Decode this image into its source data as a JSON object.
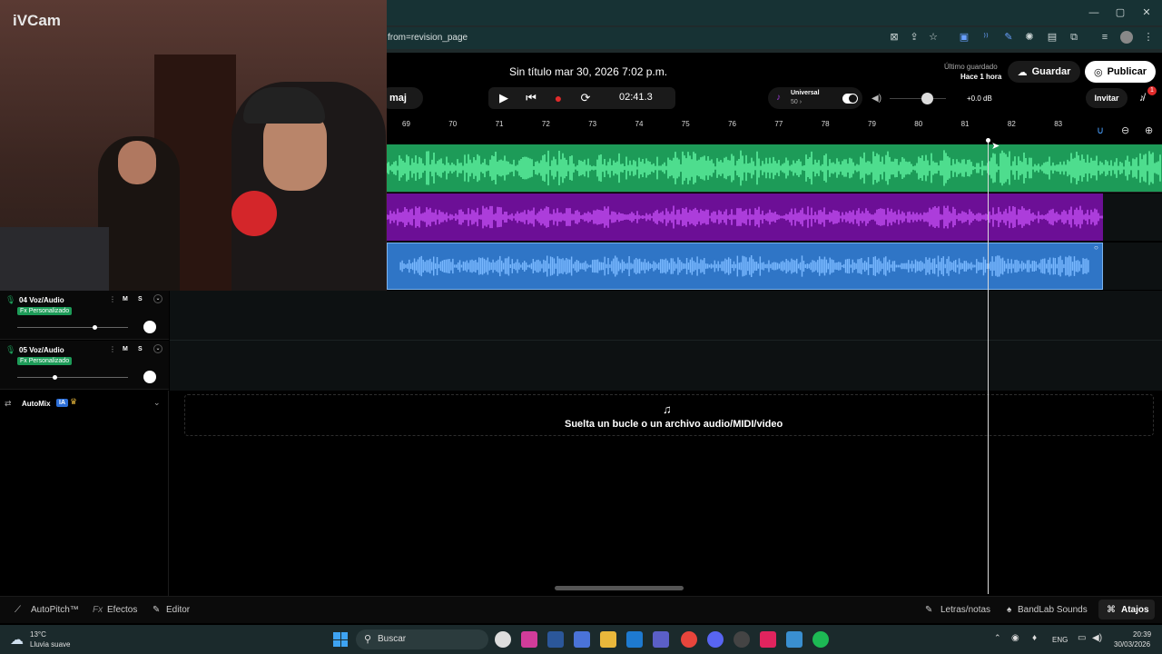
{
  "webcam": {
    "label": "iVCam"
  },
  "browser": {
    "url": "from=revision_page"
  },
  "header": {
    "title": "Sin título mar 30, 2026 7:02 p.m.",
    "saved_label": "Último guardado",
    "saved_time": "Hace 1 hora",
    "save_button": "Guardar",
    "publish_button": "Publicar",
    "invite_button": "Invitar",
    "notification_count": "1",
    "key_label": "maj"
  },
  "transport": {
    "time": "02:41.3",
    "universal_label": "Universal",
    "universal_value": "50 ›",
    "gain": "+0.0 dB"
  },
  "ruler": [
    "69",
    "70",
    "71",
    "72",
    "73",
    "74",
    "75",
    "76",
    "77",
    "78",
    "79",
    "80",
    "81",
    "82",
    "83"
  ],
  "tracks": [
    {
      "name": "04 Voz/Audio",
      "fx": "Fx Personalizado",
      "m": "M",
      "s": "S"
    },
    {
      "name": "05 Voz/Audio",
      "fx": "Fx Personalizado",
      "m": "M",
      "s": "S"
    }
  ],
  "automix": {
    "label": "AutoMix",
    "badge": "IA"
  },
  "drop_zone": {
    "text": "Suelta un bucle o un archivo audio/MIDI/video"
  },
  "bottombar": {
    "autopitch": "AutoPitch™",
    "efectos": "Efectos",
    "editor": "Editor",
    "letras": "Letras/notas",
    "bandlab": "BandLab Sounds",
    "atajos": "Atajos"
  },
  "taskbar": {
    "temp": "13°C",
    "weather": "Lluvia suave",
    "search": "Buscar",
    "lang": "ENG",
    "time": "20:39",
    "date": "30/03/2026"
  },
  "colors": {
    "track1": "#1d9b58",
    "track2": "#6c0f96",
    "track3": "#2f75c6",
    "accent": "#1d9b58"
  }
}
